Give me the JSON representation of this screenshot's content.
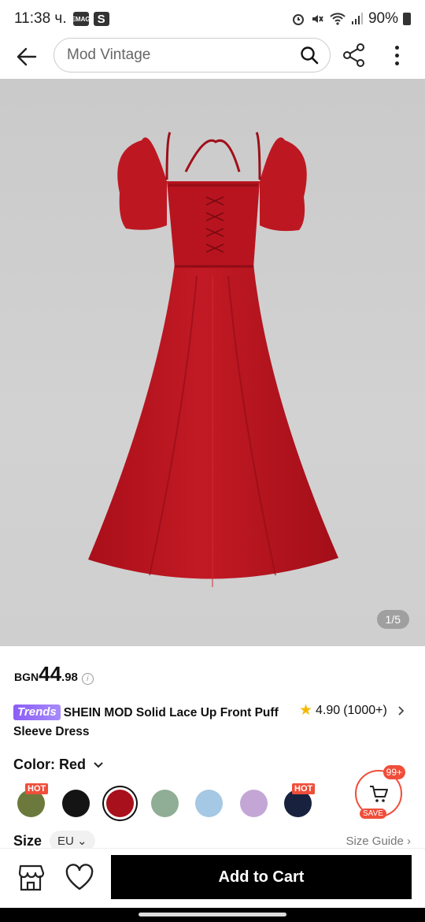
{
  "status_bar": {
    "time": "11:38 ч.",
    "badge1": "EMAG",
    "badge2": "S",
    "battery": "90%"
  },
  "header": {
    "search_placeholder": "Mod Vintage"
  },
  "gallery": {
    "counter": "1/5"
  },
  "price": {
    "currency": "BGN",
    "integer": "44",
    "decimal": ".98"
  },
  "product": {
    "badge": "Trends",
    "title": "SHEIN MOD Solid Lace Up Front Puff Sleeve Dress",
    "rating": "4.90",
    "review_count": "(1000+)"
  },
  "color": {
    "label": "Color: Red",
    "swatches": [
      {
        "name": "olive",
        "color": "#6b7a3c",
        "hot": "HOT"
      },
      {
        "name": "black",
        "color": "#141414",
        "hot": ""
      },
      {
        "name": "red",
        "color": "#a8101c",
        "hot": "",
        "selected": true
      },
      {
        "name": "sage",
        "color": "#8fae95",
        "hot": ""
      },
      {
        "name": "light-blue",
        "color": "#a5c8e4",
        "hot": ""
      },
      {
        "name": "lilac",
        "color": "#c3a6d6",
        "hot": ""
      },
      {
        "name": "navy",
        "color": "#18223f",
        "hot": "HOT"
      }
    ]
  },
  "cart": {
    "count": "99+",
    "save": "SAVE"
  },
  "size": {
    "label": "Size",
    "region": "EU",
    "guide": "Size Guide"
  },
  "bottom": {
    "add_to_cart": "Add to Cart"
  },
  "colors": {
    "accent": "#ef4e3a",
    "trends": "#8b5cf6",
    "dress": "#b4141e"
  }
}
